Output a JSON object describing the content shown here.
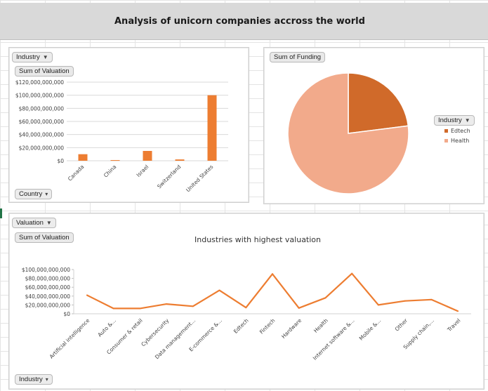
{
  "header": {
    "title": "Analysis of unicorn companies accross the world"
  },
  "colors": {
    "accent": "#ED7D31",
    "edtech": "#D06A2A",
    "health": "#F2AA8B",
    "line": "#ED7D31"
  },
  "left_panel": {
    "filter_label": "Industry",
    "value_label": "Sum of Valuation",
    "axis_field_label": "Country",
    "filter_icon": "funnel-icon",
    "dropdown_icon": "dropdown-arrow-icon"
  },
  "right_panel": {
    "value_label": "Sum of Funding",
    "legend_title": "Industry",
    "legend_icon": "funnel-icon"
  },
  "bottom_panel": {
    "filter_label": "Valuation",
    "value_label": "Sum of Valuation",
    "axis_field_label": "Industry",
    "chart_title": "Industries with highest valuation"
  },
  "chart_data": [
    {
      "type": "bar",
      "categories": [
        "Canada",
        "China",
        "Israel",
        "Switzerland",
        "United States"
      ],
      "values": [
        10000000000,
        1000000000,
        15000000000,
        2000000000,
        100000000000
      ],
      "ylim": [
        0,
        120000000000
      ],
      "yticks": [
        "$0",
        "$20,000,000,000",
        "$40,000,000,000",
        "$60,000,000,000",
        "$80,000,000,000",
        "$100,000,000,000",
        "$120,000,000,000"
      ],
      "title": "",
      "xlabel": "",
      "ylabel": "",
      "grid": true,
      "legend": "none"
    },
    {
      "type": "pie",
      "labels": [
        "Edtech",
        "Health"
      ],
      "values": [
        23,
        77
      ],
      "colors": [
        "#D06A2A",
        "#F2AA8B"
      ],
      "legend": "right"
    },
    {
      "type": "line",
      "title": "Industries with highest valuation",
      "categories": [
        "Artificial intelligence",
        "Auto &...",
        "Consumer & retail",
        "Cybersecurity",
        "Data management...",
        "E-commerce &...",
        "Edtech",
        "Fintech",
        "Hardware",
        "Health",
        "Internet software &...",
        "Mobile &...",
        "Other",
        "Supply chain,...",
        "Travel"
      ],
      "values": [
        42000000000,
        12000000000,
        12000000000,
        22000000000,
        17000000000,
        53000000000,
        14000000000,
        90000000000,
        13000000000,
        36000000000,
        91000000000,
        20000000000,
        29000000000,
        32000000000,
        6000000000
      ],
      "ylim": [
        0,
        100000000000
      ],
      "yticks": [
        "$0",
        "$20,000,000,000",
        "$40,000,000,000",
        "$60,000,000,000",
        "$80,000,000,000",
        "$100,000,000,000"
      ],
      "grid": false,
      "legend": "none"
    }
  ]
}
